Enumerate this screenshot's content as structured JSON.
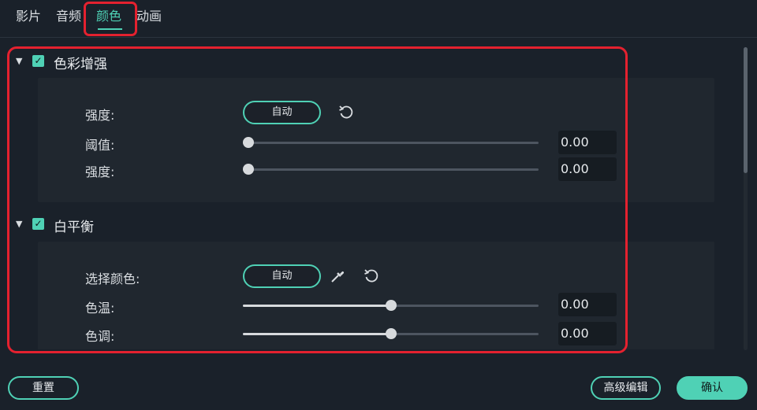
{
  "tabs": [
    {
      "label": "影片"
    },
    {
      "label": "音频"
    },
    {
      "label": "颜色"
    },
    {
      "label": "动画"
    }
  ],
  "active_tab": "颜色",
  "sections": {
    "enhance": {
      "title": "色彩增强",
      "checked": true,
      "strength_label": "强度:",
      "auto_label": "自动",
      "threshold_label": "阈值:",
      "threshold_value": "0.00",
      "amount_label": "强度:",
      "amount_value": "0.00"
    },
    "white_balance": {
      "title": "白平衡",
      "checked": true,
      "pick_label": "选择颜色:",
      "auto_label": "自动",
      "temp_label": "色温:",
      "temp_value": "0.00",
      "tint_label": "色调:",
      "tint_value": "0.00"
    }
  },
  "footer": {
    "reset_label": "重置",
    "advanced_label": "高级编辑",
    "ok_label": "确认"
  },
  "slider_levels": {
    "threshold": 0,
    "amount": 0,
    "temp": 0.5,
    "tint": 0.5
  },
  "colors": {
    "accent": "#4fd1b5",
    "highlight": "#e4212f",
    "background": "#1a212a"
  }
}
